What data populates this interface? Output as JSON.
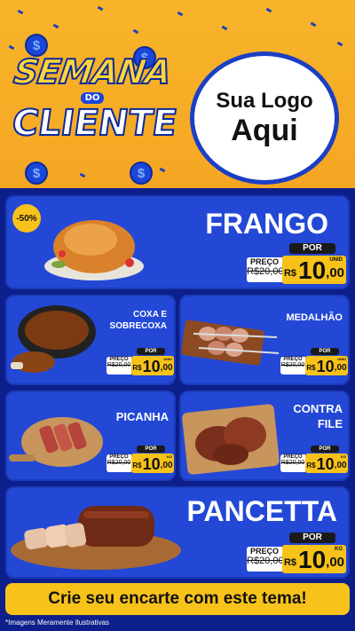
{
  "header": {
    "brand_top": "SEMANA",
    "brand_mid": "DO",
    "brand_bottom": "CLIENTE",
    "logo_line1": "Sua Logo",
    "logo_line2": "Aqui",
    "coin_symbol": "$"
  },
  "products": [
    {
      "name": "FRANGO",
      "badge": "-50%",
      "por": "POR",
      "old_label": "PREÇO",
      "old_price": "R$20,00",
      "currency": "R$",
      "price_int": "10",
      "price_dec": ",00",
      "unit": "UNID"
    },
    {
      "name": "COXA E SOBRECOXA",
      "por": "POR",
      "old_label": "PREÇO",
      "old_price": "R$20,00",
      "currency": "R$",
      "price_int": "10",
      "price_dec": ",00",
      "unit": "UNID"
    },
    {
      "name": "MEDALHÃO",
      "por": "POR",
      "old_label": "PREÇO",
      "old_price": "R$20,00",
      "currency": "R$",
      "price_int": "10",
      "price_dec": ",00",
      "unit": "UNID"
    },
    {
      "name": "PICANHA",
      "por": "POR",
      "old_label": "PREÇO",
      "old_price": "R$20,00",
      "currency": "R$",
      "price_int": "10",
      "price_dec": ",00",
      "unit": "KG"
    },
    {
      "name": "CONTRA FILE",
      "por": "POR",
      "old_label": "PREÇO",
      "old_price": "R$20,00",
      "currency": "R$",
      "price_int": "10",
      "price_dec": ",00",
      "unit": "KG"
    },
    {
      "name": "PANCETTA",
      "por": "POR",
      "old_label": "PREÇO",
      "old_price": "R$20,00",
      "currency": "R$",
      "price_int": "10",
      "price_dec": ",00",
      "unit": "KG"
    }
  ],
  "cta": "Crie seu encarte com este tema!",
  "footnote": "*Imagens Meramente Ilustrativas",
  "colors": {
    "primary_blue": "#2348d6",
    "dark_blue": "#0d1f8a",
    "yellow": "#f7c21a",
    "orange": "#f5a623"
  },
  "icons": [
    "coin-icon",
    "chicken-image",
    "drumstick-image",
    "skewer-image",
    "picanha-image",
    "steak-image",
    "pancetta-image"
  ]
}
